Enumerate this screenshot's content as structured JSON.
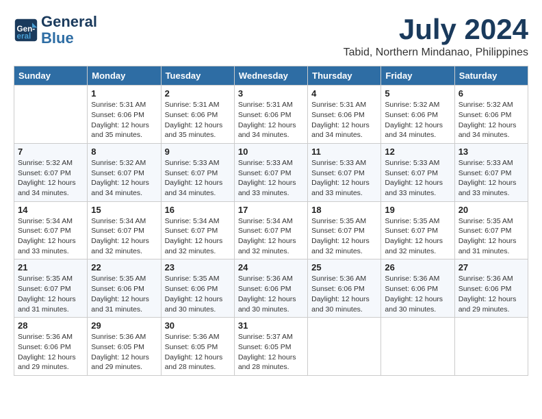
{
  "header": {
    "logo_line1": "General",
    "logo_line2": "Blue",
    "month": "July 2024",
    "location": "Tabid, Northern Mindanao, Philippines"
  },
  "days_of_week": [
    "Sunday",
    "Monday",
    "Tuesday",
    "Wednesday",
    "Thursday",
    "Friday",
    "Saturday"
  ],
  "weeks": [
    [
      {
        "day": "",
        "info": ""
      },
      {
        "day": "1",
        "info": "Sunrise: 5:31 AM\nSunset: 6:06 PM\nDaylight: 12 hours\nand 35 minutes."
      },
      {
        "day": "2",
        "info": "Sunrise: 5:31 AM\nSunset: 6:06 PM\nDaylight: 12 hours\nand 35 minutes."
      },
      {
        "day": "3",
        "info": "Sunrise: 5:31 AM\nSunset: 6:06 PM\nDaylight: 12 hours\nand 34 minutes."
      },
      {
        "day": "4",
        "info": "Sunrise: 5:31 AM\nSunset: 6:06 PM\nDaylight: 12 hours\nand 34 minutes."
      },
      {
        "day": "5",
        "info": "Sunrise: 5:32 AM\nSunset: 6:06 PM\nDaylight: 12 hours\nand 34 minutes."
      },
      {
        "day": "6",
        "info": "Sunrise: 5:32 AM\nSunset: 6:06 PM\nDaylight: 12 hours\nand 34 minutes."
      }
    ],
    [
      {
        "day": "7",
        "info": "Sunrise: 5:32 AM\nSunset: 6:07 PM\nDaylight: 12 hours\nand 34 minutes."
      },
      {
        "day": "8",
        "info": "Sunrise: 5:32 AM\nSunset: 6:07 PM\nDaylight: 12 hours\nand 34 minutes."
      },
      {
        "day": "9",
        "info": "Sunrise: 5:33 AM\nSunset: 6:07 PM\nDaylight: 12 hours\nand 34 minutes."
      },
      {
        "day": "10",
        "info": "Sunrise: 5:33 AM\nSunset: 6:07 PM\nDaylight: 12 hours\nand 33 minutes."
      },
      {
        "day": "11",
        "info": "Sunrise: 5:33 AM\nSunset: 6:07 PM\nDaylight: 12 hours\nand 33 minutes."
      },
      {
        "day": "12",
        "info": "Sunrise: 5:33 AM\nSunset: 6:07 PM\nDaylight: 12 hours\nand 33 minutes."
      },
      {
        "day": "13",
        "info": "Sunrise: 5:33 AM\nSunset: 6:07 PM\nDaylight: 12 hours\nand 33 minutes."
      }
    ],
    [
      {
        "day": "14",
        "info": "Sunrise: 5:34 AM\nSunset: 6:07 PM\nDaylight: 12 hours\nand 33 minutes."
      },
      {
        "day": "15",
        "info": "Sunrise: 5:34 AM\nSunset: 6:07 PM\nDaylight: 12 hours\nand 32 minutes."
      },
      {
        "day": "16",
        "info": "Sunrise: 5:34 AM\nSunset: 6:07 PM\nDaylight: 12 hours\nand 32 minutes."
      },
      {
        "day": "17",
        "info": "Sunrise: 5:34 AM\nSunset: 6:07 PM\nDaylight: 12 hours\nand 32 minutes."
      },
      {
        "day": "18",
        "info": "Sunrise: 5:35 AM\nSunset: 6:07 PM\nDaylight: 12 hours\nand 32 minutes."
      },
      {
        "day": "19",
        "info": "Sunrise: 5:35 AM\nSunset: 6:07 PM\nDaylight: 12 hours\nand 32 minutes."
      },
      {
        "day": "20",
        "info": "Sunrise: 5:35 AM\nSunset: 6:07 PM\nDaylight: 12 hours\nand 31 minutes."
      }
    ],
    [
      {
        "day": "21",
        "info": "Sunrise: 5:35 AM\nSunset: 6:07 PM\nDaylight: 12 hours\nand 31 minutes."
      },
      {
        "day": "22",
        "info": "Sunrise: 5:35 AM\nSunset: 6:06 PM\nDaylight: 12 hours\nand 31 minutes."
      },
      {
        "day": "23",
        "info": "Sunrise: 5:35 AM\nSunset: 6:06 PM\nDaylight: 12 hours\nand 30 minutes."
      },
      {
        "day": "24",
        "info": "Sunrise: 5:36 AM\nSunset: 6:06 PM\nDaylight: 12 hours\nand 30 minutes."
      },
      {
        "day": "25",
        "info": "Sunrise: 5:36 AM\nSunset: 6:06 PM\nDaylight: 12 hours\nand 30 minutes."
      },
      {
        "day": "26",
        "info": "Sunrise: 5:36 AM\nSunset: 6:06 PM\nDaylight: 12 hours\nand 30 minutes."
      },
      {
        "day": "27",
        "info": "Sunrise: 5:36 AM\nSunset: 6:06 PM\nDaylight: 12 hours\nand 29 minutes."
      }
    ],
    [
      {
        "day": "28",
        "info": "Sunrise: 5:36 AM\nSunset: 6:06 PM\nDaylight: 12 hours\nand 29 minutes."
      },
      {
        "day": "29",
        "info": "Sunrise: 5:36 AM\nSunset: 6:05 PM\nDaylight: 12 hours\nand 29 minutes."
      },
      {
        "day": "30",
        "info": "Sunrise: 5:36 AM\nSunset: 6:05 PM\nDaylight: 12 hours\nand 28 minutes."
      },
      {
        "day": "31",
        "info": "Sunrise: 5:37 AM\nSunset: 6:05 PM\nDaylight: 12 hours\nand 28 minutes."
      },
      {
        "day": "",
        "info": ""
      },
      {
        "day": "",
        "info": ""
      },
      {
        "day": "",
        "info": ""
      }
    ]
  ]
}
